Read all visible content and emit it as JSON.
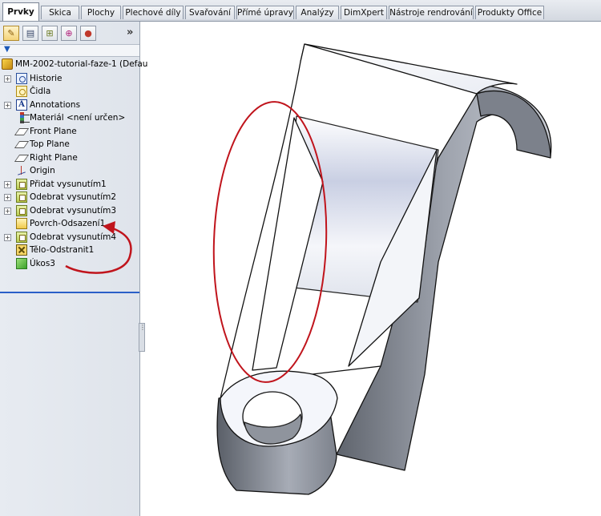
{
  "tabs": [
    {
      "label": "Prvky",
      "active": true
    },
    {
      "label": "Skica"
    },
    {
      "label": "Plochy"
    },
    {
      "label": "Plechové díly"
    },
    {
      "label": "Svařování"
    },
    {
      "label": "Přímé úpravy"
    },
    {
      "label": "Analýzy"
    },
    {
      "label": "DimXpert"
    },
    {
      "label": "Nástroje rendrování"
    },
    {
      "label": "Produkty Office"
    }
  ],
  "manager": {
    "more_label": "»",
    "root": "MM-2002-tutorial-faze-1  (Defau",
    "items": [
      {
        "label": "Historie",
        "icon": "history-icon"
      },
      {
        "label": "Čidla",
        "icon": "sensors-icon"
      },
      {
        "label": "Annotations",
        "icon": "annotations-icon"
      },
      {
        "label": "Materiál <není určen>",
        "icon": "material-icon"
      },
      {
        "label": "Front Plane",
        "icon": "plane-icon"
      },
      {
        "label": "Top Plane",
        "icon": "plane-icon"
      },
      {
        "label": "Right Plane",
        "icon": "plane-icon"
      },
      {
        "label": "Origin",
        "icon": "origin-icon"
      },
      {
        "label": "Přidat vysunutím1",
        "icon": "boss-extrude-icon"
      },
      {
        "label": "Odebrat vysunutím2",
        "icon": "cut-extrude-icon"
      },
      {
        "label": "Odebrat vysunutím3",
        "icon": "cut-extrude-icon"
      },
      {
        "label": "Povrch-Odsazení1",
        "icon": "offset-surface-icon"
      },
      {
        "label": "Odebrat vysunutím4",
        "icon": "cut-extrude-icon"
      },
      {
        "label": "Tělo-Odstranit1",
        "icon": "delete-body-icon"
      },
      {
        "label": "Úkos3",
        "icon": "draft-icon"
      }
    ]
  },
  "colors": {
    "annotation_red": "#c0141c",
    "rollback_bar": "#2a5fc8",
    "model_shade_light": "#f4f6fb",
    "model_shade_dark": "#6e737d"
  }
}
